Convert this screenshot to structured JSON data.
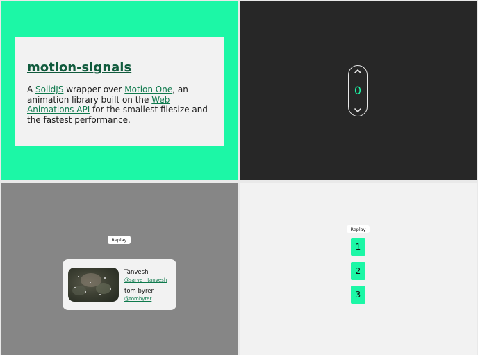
{
  "intro": {
    "title": "motion-signals",
    "text_a": "A ",
    "link_solidjs": "SolidJS",
    "text_b": " wrapper over ",
    "link_motion_one": "Motion One",
    "text_c": ", an animation library built on the ",
    "link_web_animations": "Web Animations API",
    "text_d": " for the smallest filesize and the fastest performance."
  },
  "counter": {
    "value": "0",
    "up_icon": "chevron-up-icon",
    "down_icon": "chevron-down-icon"
  },
  "profile_demo": {
    "replay_label": "Replay",
    "users": [
      {
        "name": "Tanvesh",
        "handle": "@sarve__tanvesh"
      },
      {
        "name": "tom byrer",
        "handle": "@tombyrer"
      }
    ]
  },
  "list_demo": {
    "replay_label": "Replay",
    "items": [
      "1",
      "2",
      "3"
    ]
  },
  "colors": {
    "accent": "#1cf7a6",
    "dark_bg": "#272727",
    "grey_bg": "#868686",
    "light_bg": "#f2f2f2",
    "link": "#0f7a4d"
  }
}
